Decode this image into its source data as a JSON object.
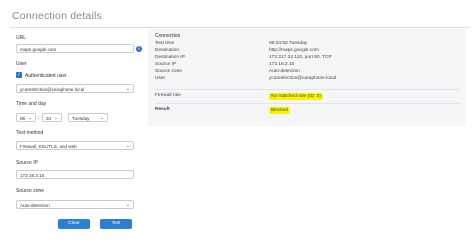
{
  "title": "Connection details",
  "form": {
    "url_label": "URL",
    "url_value": "maps.google.com",
    "user_label": "User",
    "auth_user_label": "Authenticated user",
    "user_value": "ycorestriction@caraphone.local",
    "time_label": "Time and day",
    "hour_value": "06",
    "minute_value": "34",
    "day_value": "Tuesday",
    "method_label": "Test method",
    "method_value": "Firewall, SSL/TLS, and web",
    "source_ip_label": "Source IP",
    "source_ip_value": "172.16.2.10",
    "source_zone_label": "Source zone",
    "source_zone_value": "Auto-detection",
    "clear_label": "Clear",
    "test_label": "Test"
  },
  "result_panel": {
    "heading": "Connection",
    "rows": [
      {
        "key": "Test time",
        "value": "06:34:53 Tuesday"
      },
      {
        "key": "Destination",
        "value": "http://maps.google.com"
      },
      {
        "key": "Destination IP",
        "value": "172.217.22.110, port 80, TCP"
      },
      {
        "key": "Source IP",
        "value": "172.16.2.10"
      },
      {
        "key": "Source zone",
        "value": "Auto-detection"
      },
      {
        "key": "User",
        "value": "ycorestriction@caraphone.local"
      }
    ],
    "firewall_rule_label": "Firewall rule",
    "firewall_rule_value": "No matched rule (ID: 0)",
    "result_label": "Result",
    "result_value": "Blocked"
  },
  "colors": {
    "accent": "#2d6ec8",
    "highlight": "#fff200",
    "panel_bg": "#f4f6f8"
  }
}
